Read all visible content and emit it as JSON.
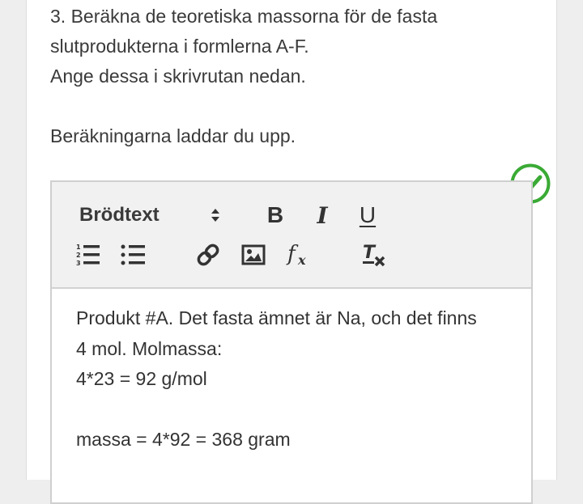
{
  "question": {
    "line1": "3. Beräkna de teoretiska massorna för de fasta",
    "line2": "slutprodukterna i formlerna A-F.",
    "line3": "Ange dessa i skrivrutan nedan.",
    "line4": "Beräkningarna laddar du upp."
  },
  "status": {
    "icon": "check-circle-icon",
    "color": "#3aaa35"
  },
  "toolbar": {
    "format_value": "Brödtext",
    "bold_label": "B",
    "italic_label": "I",
    "underline_label": "U",
    "icons": [
      "ordered-list-icon",
      "bullet-list-icon",
      "link-icon",
      "image-icon",
      "formula-icon",
      "clear-format-icon"
    ]
  },
  "editor": {
    "lines": [
      "Produkt #A. Det fasta ämnet är Na, och det finns",
      "4 mol. Molmassa:",
      "4*23 = 92 g/mol",
      "",
      "massa = 4*92 = 368 gram"
    ]
  }
}
